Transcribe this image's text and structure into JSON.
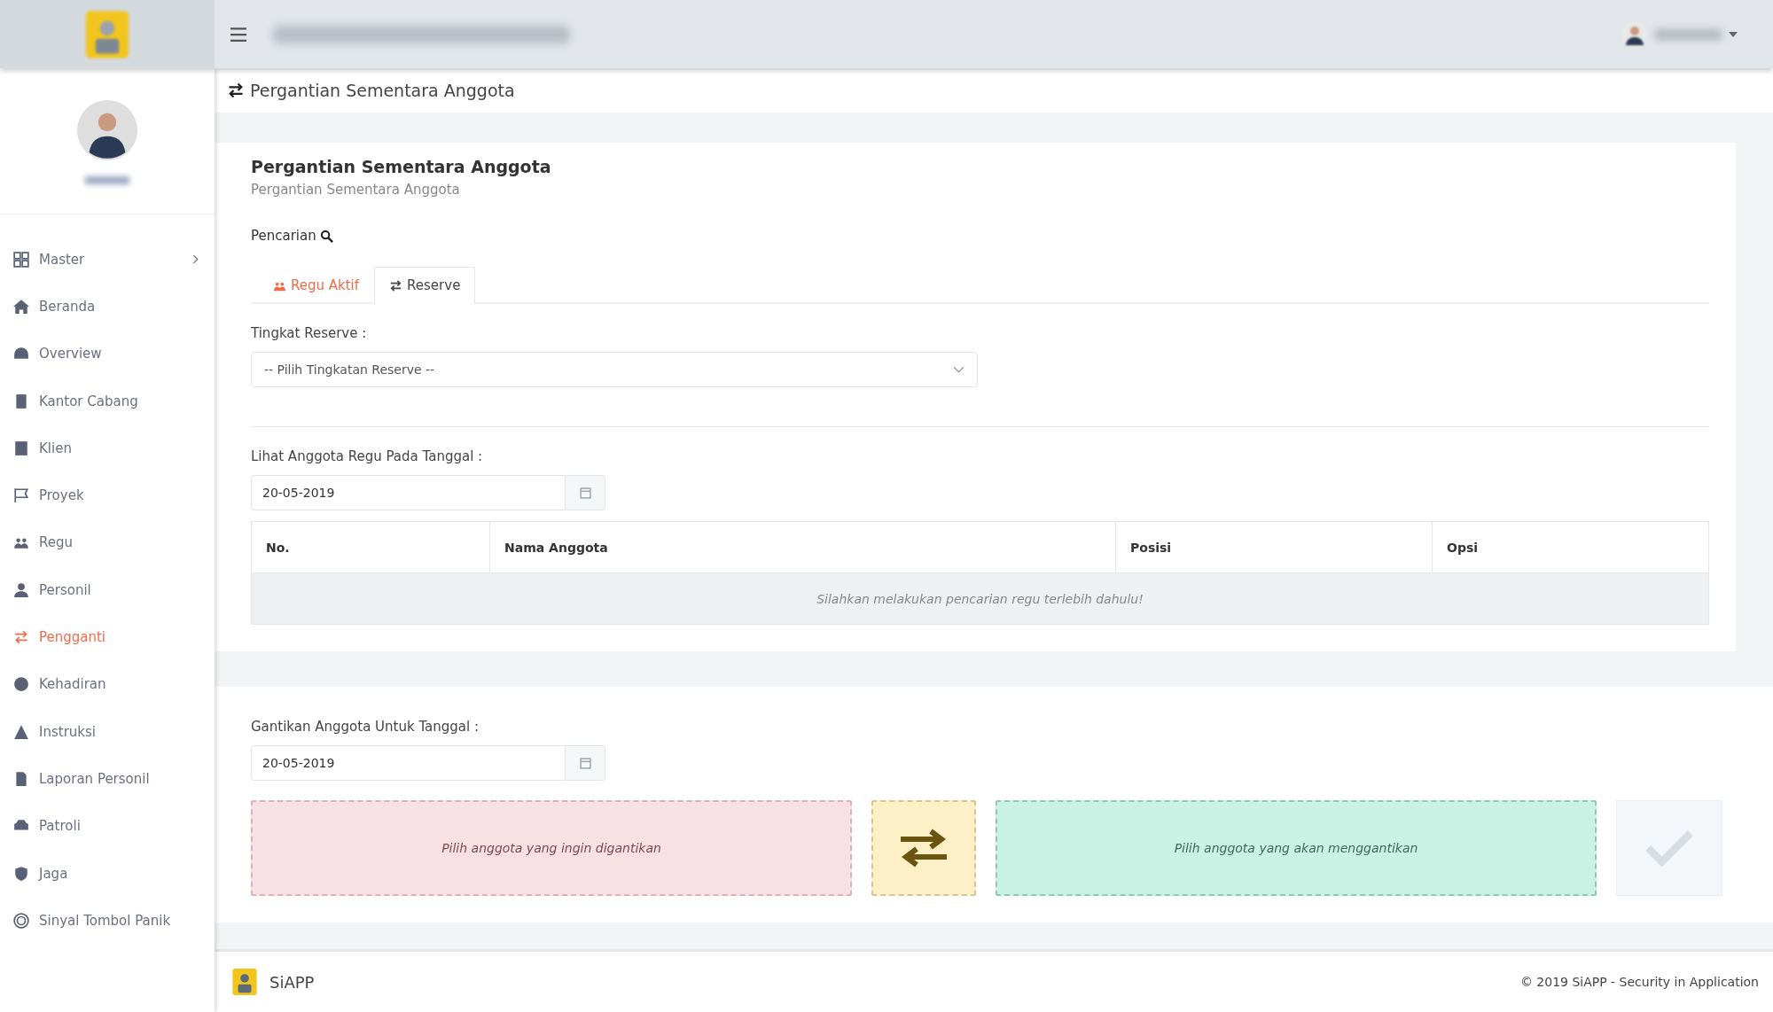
{
  "sidebar": {
    "items": [
      {
        "label": "Master",
        "selected": false,
        "has_submenu": true
      },
      {
        "label": "Beranda",
        "selected": false,
        "has_submenu": false
      },
      {
        "label": "Overview",
        "selected": false,
        "has_submenu": false
      },
      {
        "label": "Kantor Cabang",
        "selected": false,
        "has_submenu": false
      },
      {
        "label": "Klien",
        "selected": false,
        "has_submenu": false
      },
      {
        "label": "Proyek",
        "selected": false,
        "has_submenu": false
      },
      {
        "label": "Regu",
        "selected": false,
        "has_submenu": false
      },
      {
        "label": "Personil",
        "selected": false,
        "has_submenu": false
      },
      {
        "label": "Pengganti",
        "selected": true,
        "has_submenu": false
      },
      {
        "label": "Kehadiran",
        "selected": false,
        "has_submenu": false
      },
      {
        "label": "Instruksi",
        "selected": false,
        "has_submenu": false
      },
      {
        "label": "Laporan Personil",
        "selected": false,
        "has_submenu": false
      },
      {
        "label": "Patroli",
        "selected": false,
        "has_submenu": false
      },
      {
        "label": "Jaga",
        "selected": false,
        "has_submenu": false
      },
      {
        "label": "Sinyal Tombol Panik",
        "selected": false,
        "has_submenu": false
      }
    ]
  },
  "breadcrumb": "Pergantian Sementara Anggota",
  "card": {
    "title": "Pergantian Sementara Anggota",
    "subtitle": "Pergantian Sementara Anggota",
    "search_label": "Pencarian"
  },
  "tabs": [
    {
      "label": "Regu Aktif",
      "selected": false
    },
    {
      "label": "Reserve",
      "selected": true
    }
  ],
  "reserve_level": {
    "label": "Tingkat Reserve :",
    "value": "-- Pilih Tingkatan Reserve --"
  },
  "view_date": {
    "label": "Lihat Anggota Regu Pada Tanggal :",
    "value": "20-05-2019"
  },
  "table": {
    "columns": [
      "No.",
      "Nama Anggota",
      "Posisi",
      "Opsi"
    ],
    "empty_message": "Silahkan melakukan pencarian regu terlebih dahulu!"
  },
  "replace_date": {
    "label": "Gantikan Anggota Untuk Tanggal :",
    "value": "20-05-2019"
  },
  "swap": {
    "from_placeholder": "Pilih anggota yang ingin digantikan",
    "to_placeholder": "Pilih anggota yang akan menggantikan",
    "confirm_disabled": true
  },
  "footer": {
    "brand": "SiAPP",
    "copyright": "© 2019 SiAPP - Security in Application"
  }
}
